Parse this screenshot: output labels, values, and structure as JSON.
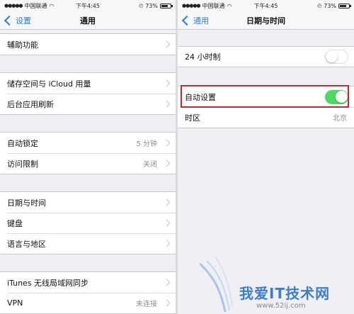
{
  "statusbar": {
    "carrier": "中国联通",
    "time": "下午4:45",
    "battery": "73%",
    "battery_level": 0.73
  },
  "left": {
    "back_label": "设置",
    "title": "通用",
    "groups": [
      [
        {
          "label": "辅助功能",
          "value": ""
        }
      ],
      [
        {
          "label": "储存空间与 iCloud 用量",
          "value": ""
        },
        {
          "label": "后台应用刷新",
          "value": ""
        }
      ],
      [
        {
          "label": "自动锁定",
          "value": "5 分钟"
        },
        {
          "label": "访问限制",
          "value": "关闭"
        }
      ],
      [
        {
          "label": "日期与时间",
          "value": ""
        },
        {
          "label": "键盘",
          "value": ""
        },
        {
          "label": "语言与地区",
          "value": ""
        }
      ],
      [
        {
          "label": "iTunes 无线局域网同步",
          "value": ""
        },
        {
          "label": "VPN",
          "value": "未连接"
        }
      ]
    ]
  },
  "right": {
    "back_label": "通用",
    "title": "日期与时间",
    "row_24h": {
      "label": "24 小时制",
      "on": false
    },
    "row_auto": {
      "label": "自动设置",
      "on": true
    },
    "row_timezone": {
      "label": "时区",
      "value": "北京"
    }
  },
  "watermark": {
    "text": "我爱IT技术网",
    "url": "www.52ij.com"
  },
  "colors": {
    "accent": "#1e7ef0",
    "toggle_on": "#4cd964",
    "highlight": "#d0232d",
    "background": "#efeff4"
  }
}
